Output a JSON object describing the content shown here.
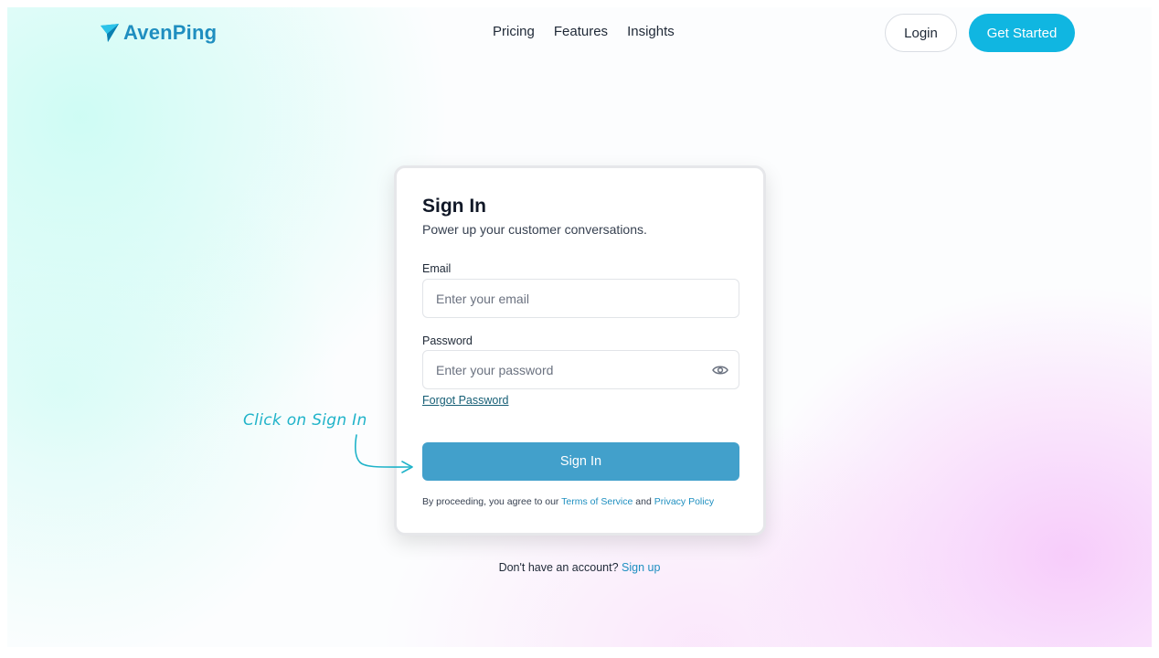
{
  "header": {
    "brand": "AvenPing",
    "nav": [
      "Pricing",
      "Features",
      "Insights"
    ],
    "login_label": "Login",
    "get_started_label": "Get Started"
  },
  "signin": {
    "title": "Sign In",
    "subtitle": "Power up your customer conversations.",
    "email_label": "Email",
    "email_placeholder": "Enter your email",
    "password_label": "Password",
    "password_placeholder": "Enter your password",
    "forgot_label": "Forgot Password",
    "submit_label": "Sign In",
    "terms_prefix": "By proceeding, you agree to our",
    "terms_link": "Terms of Service",
    "terms_and": "and",
    "privacy_link": "Privacy Policy"
  },
  "signup": {
    "prompt": "Don't have an account?",
    "link": "Sign up"
  },
  "annotation": {
    "text": "Click on Sign In"
  },
  "colors": {
    "brand": "#1f8ec0",
    "primary_button": "#10b6e1",
    "signin_button": "#42a0cb",
    "link": "#1e8fc0",
    "annotation": "#1fb3c9"
  },
  "icons": {
    "logo": "paper-plane-icon",
    "password_toggle": "eye-icon"
  }
}
